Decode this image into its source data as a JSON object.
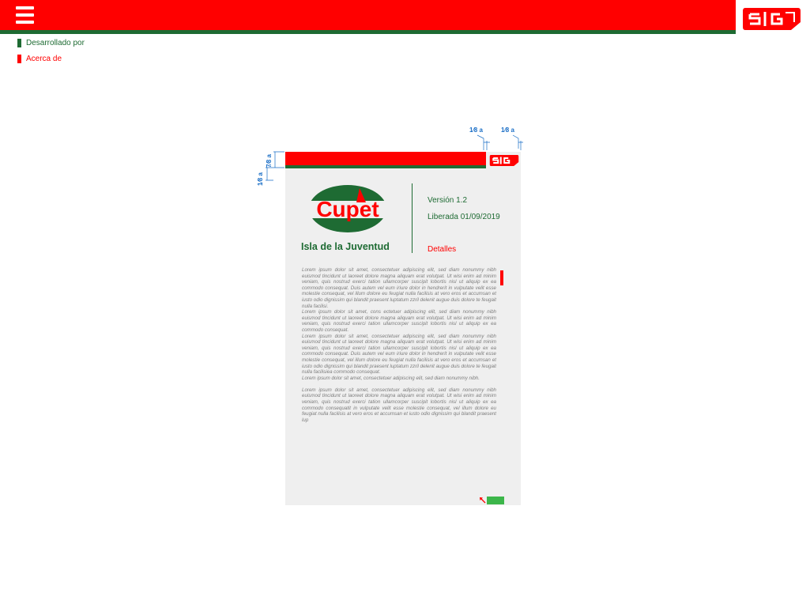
{
  "header": {
    "menu_icon": "hamburger-menu-icon",
    "brand_logo": "sig-logo",
    "colors": {
      "primary": "#ff0000",
      "secondary": "#1e6b33"
    }
  },
  "side_menu": {
    "items": [
      {
        "label": "Desarrollado por",
        "color": "#1e6b33"
      },
      {
        "label": "Acerca de",
        "color": "#ff0000"
      }
    ]
  },
  "mockup": {
    "logo_text": "Cupet",
    "subtitle": "Isla de la Juventud",
    "version": "Versión 1.2",
    "released": "Liberada 01/09/2019",
    "details_label": "Detalles",
    "paragraphs": [
      "Lorem ipsum dolor sit amet, consectetuer adipiscing elit, sed diam nonummy nibh euismod tincidunt ut laoreet dolore magna aliquam erat volutpat. Ut wisi enim ad minim veniam, quis nostrud exerci tation ullamcorper suscipit lobortis nisl ut aliquip ex ea commodo consequat. Duis autem vel eum iriure dolor in hendrerit in vulputate velit esse molestie consequat, vel illum dolore eu feugiat nulla facilisis at vero eros et accumsan et iusto odio dignissim qui blandit praesent luptatum zzril delenit augue duis dolore te feugait nulla facilisi.",
      "Lorem ipsum dolor sit amet, cons ectetuer adipiscing elit, sed diam nonummy nibh euismod tincidunt ut laoreet dolore magna aliquam erat volutpat. Ut wisi enim ad minim veniam, quis nostrud exerci tation ullamcorper suscipit lobortis nisl ut aliquip ex ea commodo consequat.",
      "Lorem ipsum dolor sit amet, consectetuer adipiscing elit, sed diam nonummy nibh euismod tincidunt ut laoreet dolore magna aliquam erat volutpat. Ut wisi enim ad minim veniam, quis nostrud exerci tation ullamcorper suscipit lobortis nisl ut aliquip ex ea commodo consequat. Duis autem vel eum iriure dolor in hendrerit in vulputate velit esse molestie consequat, vel illum dolore eu feugiat nulla facilisis at vero eros et accumsan et iusto odio dignissim qui blandit praesent luptatum zzril delenit augue duis dolore te feugait nulla facilisiea commodo consequat.",
      "Lorem ipsum dolor sit amet, consectetuer adipiscing elit, sed diam nonummy nibh.",
      "Lorem ipsum dolor sit amet, consectetuer adipiscing elit, sed diam nonummy nibh euismod tincidunt ut laoreet dolore magna aliquam erat volutpat. Ut wisi enim ad minim veniam, quis nostrud exerci tation ullamcorper suscipit lobortis nisl ut aliquip ex ea commodo consequatit in vulputate velit esse molestie consequat, vel illum dolore eu feugiat nulla facilisis at vero eros et accumsan et iusto odio dignissim qui blandit praesent lup"
    ],
    "back_button_color": "#3cb64a"
  },
  "annotations": {
    "top_margin_1": "1⁄8 a",
    "top_margin_2": "1⁄8 a",
    "bar_height": "7⁄8 a",
    "side_margin": "1⁄8 a"
  }
}
